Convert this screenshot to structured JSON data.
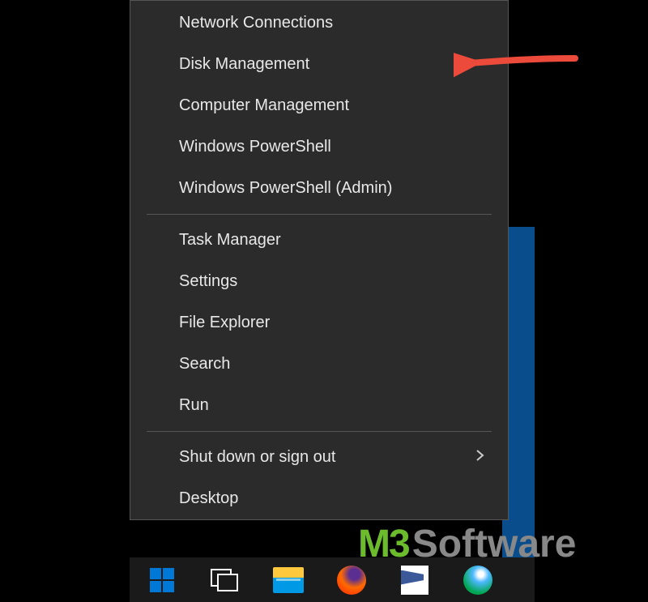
{
  "menu": {
    "group1": [
      "Network Connections",
      "Disk Management",
      "Computer Management",
      "Windows PowerShell",
      "Windows PowerShell (Admin)"
    ],
    "group2": [
      "Task Manager",
      "Settings",
      "File Explorer",
      "Search",
      "Run"
    ],
    "group3": {
      "shutdown": "Shut down or sign out",
      "desktop": "Desktop"
    }
  },
  "watermark": {
    "brand": "M3",
    "text": "Software"
  },
  "annotation": {
    "arrow_color": "#ec4a3a"
  }
}
